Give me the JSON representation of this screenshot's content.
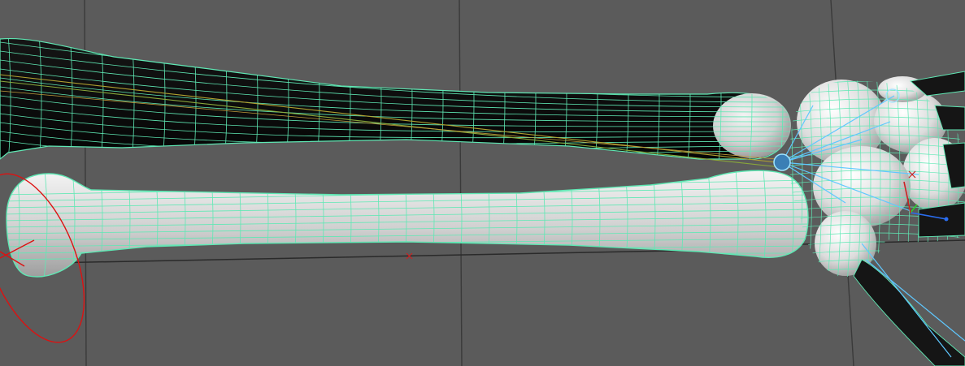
{
  "viewport": {
    "type": "3d-perspective-viewport",
    "background_color": "#5b5b5b",
    "grid_color": "#3c3c3c",
    "wireframe_color": "#5fe8b4",
    "shaded_mesh_color": "#d4d4d4",
    "selected_mesh_color": "#0a0a0a",
    "joint_color": "#5fc8ff",
    "locator_color": "#cc2222",
    "control_curve_color": "#dd1111",
    "ik_line_color": "#b0a030"
  },
  "scene": {
    "objects": [
      {
        "name": "radius-bone",
        "state": "selected",
        "icon": "bone-mesh-icon"
      },
      {
        "name": "ulna-bone",
        "state": "unselected",
        "icon": "bone-mesh-icon"
      },
      {
        "name": "carpal-bones",
        "state": "unselected",
        "icon": "bone-mesh-icon"
      },
      {
        "name": "metacarpal-bones",
        "state": "unselected",
        "icon": "bone-mesh-icon"
      },
      {
        "name": "elbow-control-curve",
        "icon": "circle-curve-icon"
      },
      {
        "name": "wrist-joint",
        "icon": "joint-icon"
      },
      {
        "name": "world-axis-gizmo",
        "icon": "axis-gizmo-icon"
      }
    ]
  }
}
